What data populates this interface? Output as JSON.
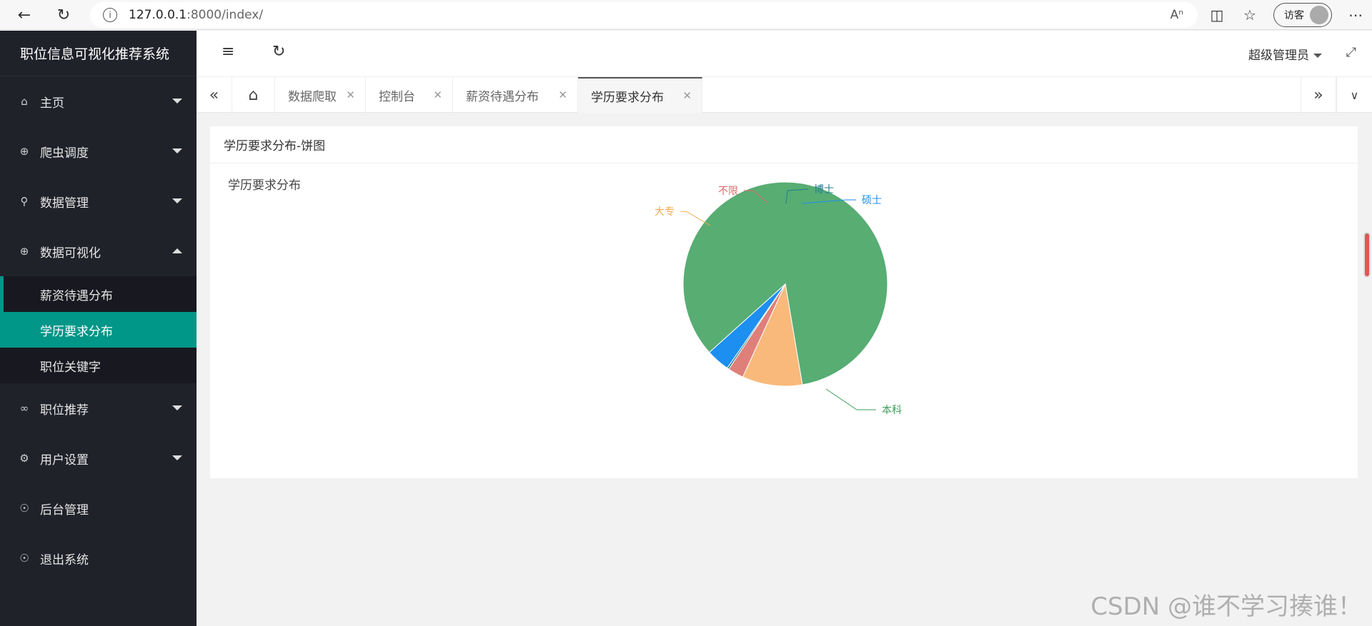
{
  "browser": {
    "url_host": "127.0.0.1",
    "url_rest": ":8000/index/",
    "guest_label": "访客"
  },
  "app": {
    "title": "职位信息可视化推荐系统"
  },
  "sidebar": {
    "items": [
      {
        "label": "主页",
        "icon": "home-icon"
      },
      {
        "label": "爬虫调度",
        "icon": "download-icon"
      },
      {
        "label": "数据管理",
        "icon": "search-icon"
      },
      {
        "label": "数据可视化",
        "icon": "download-icon"
      }
    ],
    "sub_items": [
      {
        "label": "薪资待遇分布"
      },
      {
        "label": "学历要求分布"
      },
      {
        "label": "职位关键字"
      }
    ],
    "items_after": [
      {
        "label": "职位推荐",
        "icon": "link-icon"
      },
      {
        "label": "用户设置",
        "icon": "gear-icon"
      },
      {
        "label": "后台管理",
        "icon": "shield-icon"
      },
      {
        "label": "退出系统",
        "icon": "shield-icon"
      }
    ]
  },
  "header": {
    "user": "超级管理员"
  },
  "tabs": [
    {
      "label": "数据爬取"
    },
    {
      "label": "控制台"
    },
    {
      "label": "薪资待遇分布"
    },
    {
      "label": "学历要求分布"
    }
  ],
  "card": {
    "title": "学历要求分布-饼图"
  },
  "chart_data": {
    "type": "pie",
    "title": "学历要求分布",
    "categories": [
      "本科",
      "大专",
      "不限",
      "博士",
      "硕士"
    ],
    "values": [
      84,
      9.5,
      2.5,
      0.3,
      3.7
    ],
    "colors": [
      "#58ad73",
      "#f8b97b",
      "#df7f7a",
      "#1f7f8f",
      "#1c8ff0"
    ],
    "label_colors": [
      "#3d9e5a",
      "#f2a94c",
      "#dd6b6b",
      "#1f7f8f",
      "#1c8ff0"
    ]
  },
  "watermark": "CSDN @谁不学习揍谁！"
}
